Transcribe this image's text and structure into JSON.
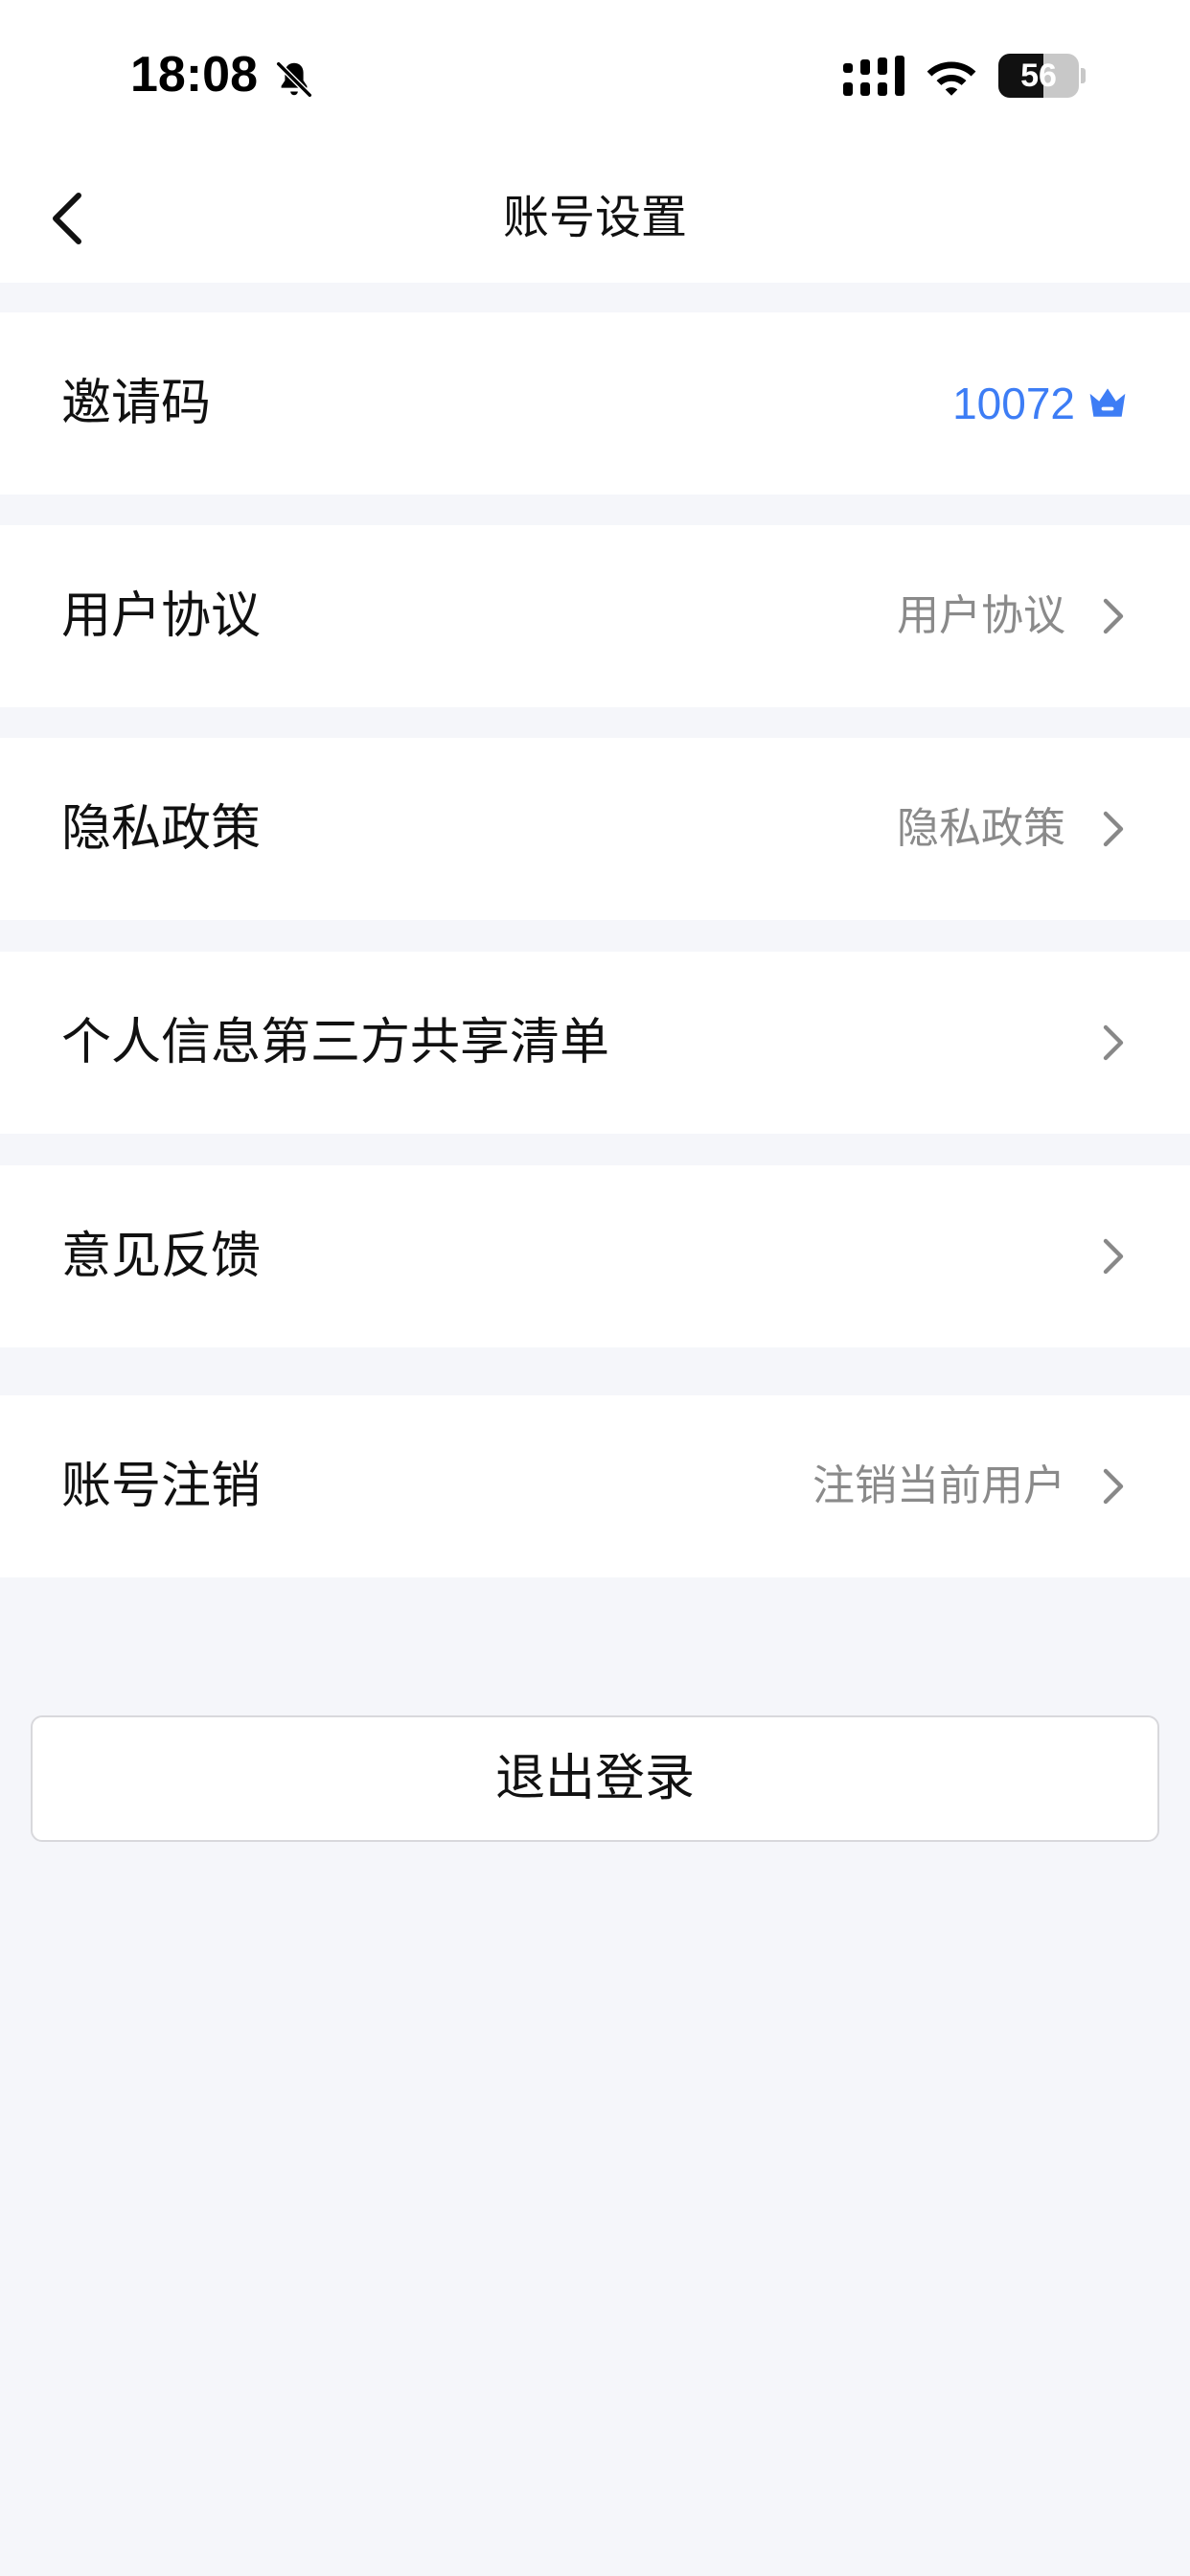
{
  "status_bar": {
    "time": "18:08",
    "battery_level": "56",
    "battery_fraction": 0.56,
    "icons": [
      "bell-slash-icon",
      "cellular-signal-icon",
      "wifi-icon",
      "battery-icon"
    ]
  },
  "nav": {
    "title": "账号设置",
    "back_icon": "chevron-left-icon"
  },
  "rows": [
    {
      "label": "邀请码",
      "value": "10072",
      "icon": "crown-icon"
    },
    {
      "label": "用户协议",
      "value": "用户协议",
      "icon": "chevron-right-icon"
    },
    {
      "label": "隐私政策",
      "value": "隐私政策",
      "icon": "chevron-right-icon"
    },
    {
      "label": "个人信息第三方共享清单",
      "value": "",
      "icon": "chevron-right-icon"
    },
    {
      "label": "意见反馈",
      "value": "",
      "icon": "chevron-right-icon"
    },
    {
      "label": "账号注销",
      "value": "注销当前用户",
      "icon": "chevron-right-icon"
    }
  ],
  "logout": {
    "label": "退出登录"
  },
  "colors": {
    "accent": "#3d7df5",
    "page_background": "#f5f6fa",
    "secondary_text": "#8a8a8a"
  }
}
